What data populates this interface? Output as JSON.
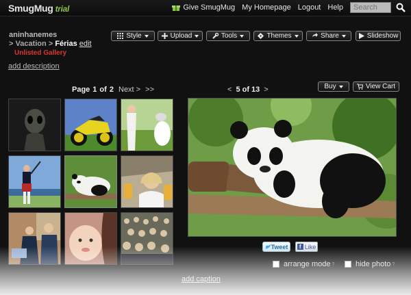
{
  "header": {
    "logo": "SmugMug",
    "logo_badge": "trial",
    "nav": [
      "Give SmugMug",
      "My Homepage",
      "Logout",
      "Help"
    ],
    "search_placeholder": "Search"
  },
  "breadcrumb": {
    "user": "aninhanemes",
    "sep": ">",
    "category": "Vacation",
    "gallery": "Férias",
    "edit": "edit"
  },
  "gallery_status": "Unlisted Gallery",
  "add_description": "add description",
  "toolbar": {
    "style": "Style",
    "upload": "Upload",
    "tools": "Tools",
    "themes": "Themes",
    "share": "Share",
    "slideshow": "Slideshow"
  },
  "pagination": {
    "page_label": "Page",
    "current": "1",
    "of": "of",
    "total": "2",
    "next": "Next >",
    "last": ">>"
  },
  "photo_nav": {
    "prev": "<",
    "position": "5 of 13",
    "next": ">"
  },
  "buy": {
    "buy": "Buy",
    "view_cart": "View Cart"
  },
  "thumbnails": [
    {
      "subject": "alien"
    },
    {
      "subject": "motorcycle"
    },
    {
      "subject": "wedding"
    },
    {
      "subject": "bagpiper"
    },
    {
      "subject": "panda",
      "selected": true
    },
    {
      "subject": "oktoberfest"
    },
    {
      "subject": "laptop"
    },
    {
      "subject": "baby"
    },
    {
      "subject": "crowd"
    }
  ],
  "main_photo": {
    "subject": "panda"
  },
  "social": {
    "tweet": "Tweet",
    "like": "Like"
  },
  "options": {
    "arrange": "arrange mode",
    "hide": "hide photo",
    "help_mark": "?"
  },
  "add_caption": "add caption",
  "colors": {
    "accent_green": "#8bc34a",
    "unlisted_red": "#dd3333",
    "background": "#111111"
  }
}
